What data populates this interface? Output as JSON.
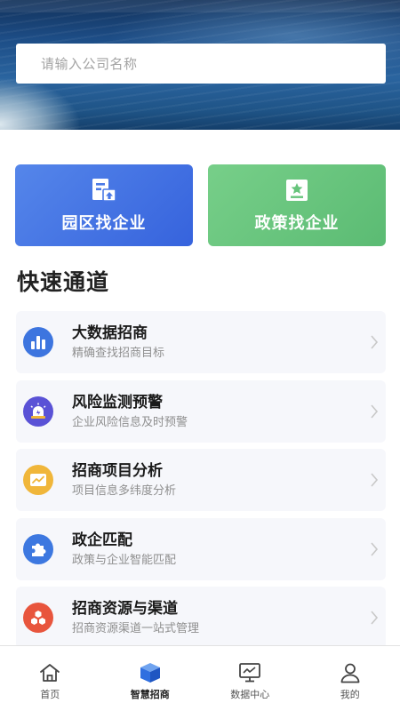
{
  "search": {
    "placeholder": "请输入公司名称"
  },
  "entries": [
    {
      "label": "园区找企业",
      "icon": "building-upload-icon",
      "color": "#4a79e6"
    },
    {
      "label": "政策找企业",
      "icon": "document-star-icon",
      "color": "#66c47b"
    }
  ],
  "section_title": "快速通道",
  "items": [
    {
      "title": "大数据招商",
      "subtitle": "精确查找招商目标",
      "icon": "bar-chart-icon",
      "color": "#3d75df"
    },
    {
      "title": "风险监测预警",
      "subtitle": "企业风险信息及时预警",
      "icon": "alarm-light-icon",
      "color": "#5a52d6"
    },
    {
      "title": "招商项目分析",
      "subtitle": "项目信息多纬度分析",
      "icon": "trend-board-icon",
      "color": "#f0b63a"
    },
    {
      "title": "政企匹配",
      "subtitle": "政策与企业智能匹配",
      "icon": "puzzle-icon",
      "color": "#3d78e0"
    },
    {
      "title": "招商资源与渠道",
      "subtitle": "招商资源渠道一站式管理",
      "icon": "hexagon-cluster-icon",
      "color": "#e8553d"
    }
  ],
  "tabs": [
    {
      "label": "首页",
      "icon": "home-icon",
      "active": false
    },
    {
      "label": "智慧招商",
      "icon": "cube-icon",
      "active": true
    },
    {
      "label": "数据中心",
      "icon": "monitor-chart-icon",
      "active": false
    },
    {
      "label": "我的",
      "icon": "user-icon",
      "active": false
    }
  ]
}
